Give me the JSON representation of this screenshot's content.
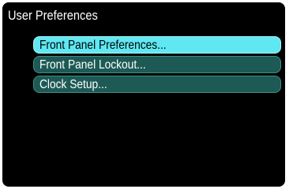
{
  "window": {
    "title": "User Preferences"
  },
  "menu": {
    "selected_index": 0,
    "items": [
      {
        "label": "Front Panel Preferences..."
      },
      {
        "label": "Front Panel Lockout..."
      },
      {
        "label": "Clock Setup..."
      }
    ]
  },
  "colors": {
    "background": "#000000",
    "selected_item": "#5fe8f2",
    "item": "#1d5a55",
    "item_border": "#3f8e86",
    "text": "#ffffff"
  }
}
